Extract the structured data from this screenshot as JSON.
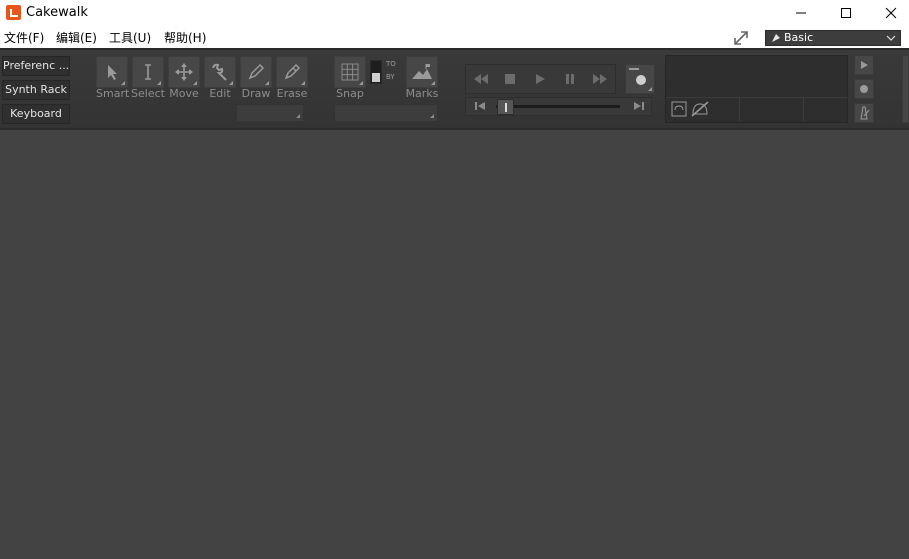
{
  "window": {
    "title": "Cakewalk"
  },
  "menu": {
    "items": [
      "文件(F)",
      "编辑(E)",
      "工具(U)",
      "帮助(H)"
    ]
  },
  "workspace": {
    "selected": "Basic"
  },
  "side_buttons": [
    "Preferenc ...",
    "Synth Rack",
    "Keyboard"
  ],
  "tools": [
    {
      "label": "Smart",
      "icon": "arrow-cursor-icon"
    },
    {
      "label": "Select",
      "icon": "ibeam-icon"
    },
    {
      "label": "Move",
      "icon": "move-arrows-icon"
    },
    {
      "label": "Edit",
      "icon": "wrench-icon"
    },
    {
      "label": "Draw",
      "icon": "pencil-icon"
    },
    {
      "label": "Erase",
      "icon": "eraser-icon"
    }
  ],
  "snap": {
    "label": "Snap",
    "to": "TO",
    "by": "BY"
  },
  "marks": {
    "label": "Marks"
  }
}
